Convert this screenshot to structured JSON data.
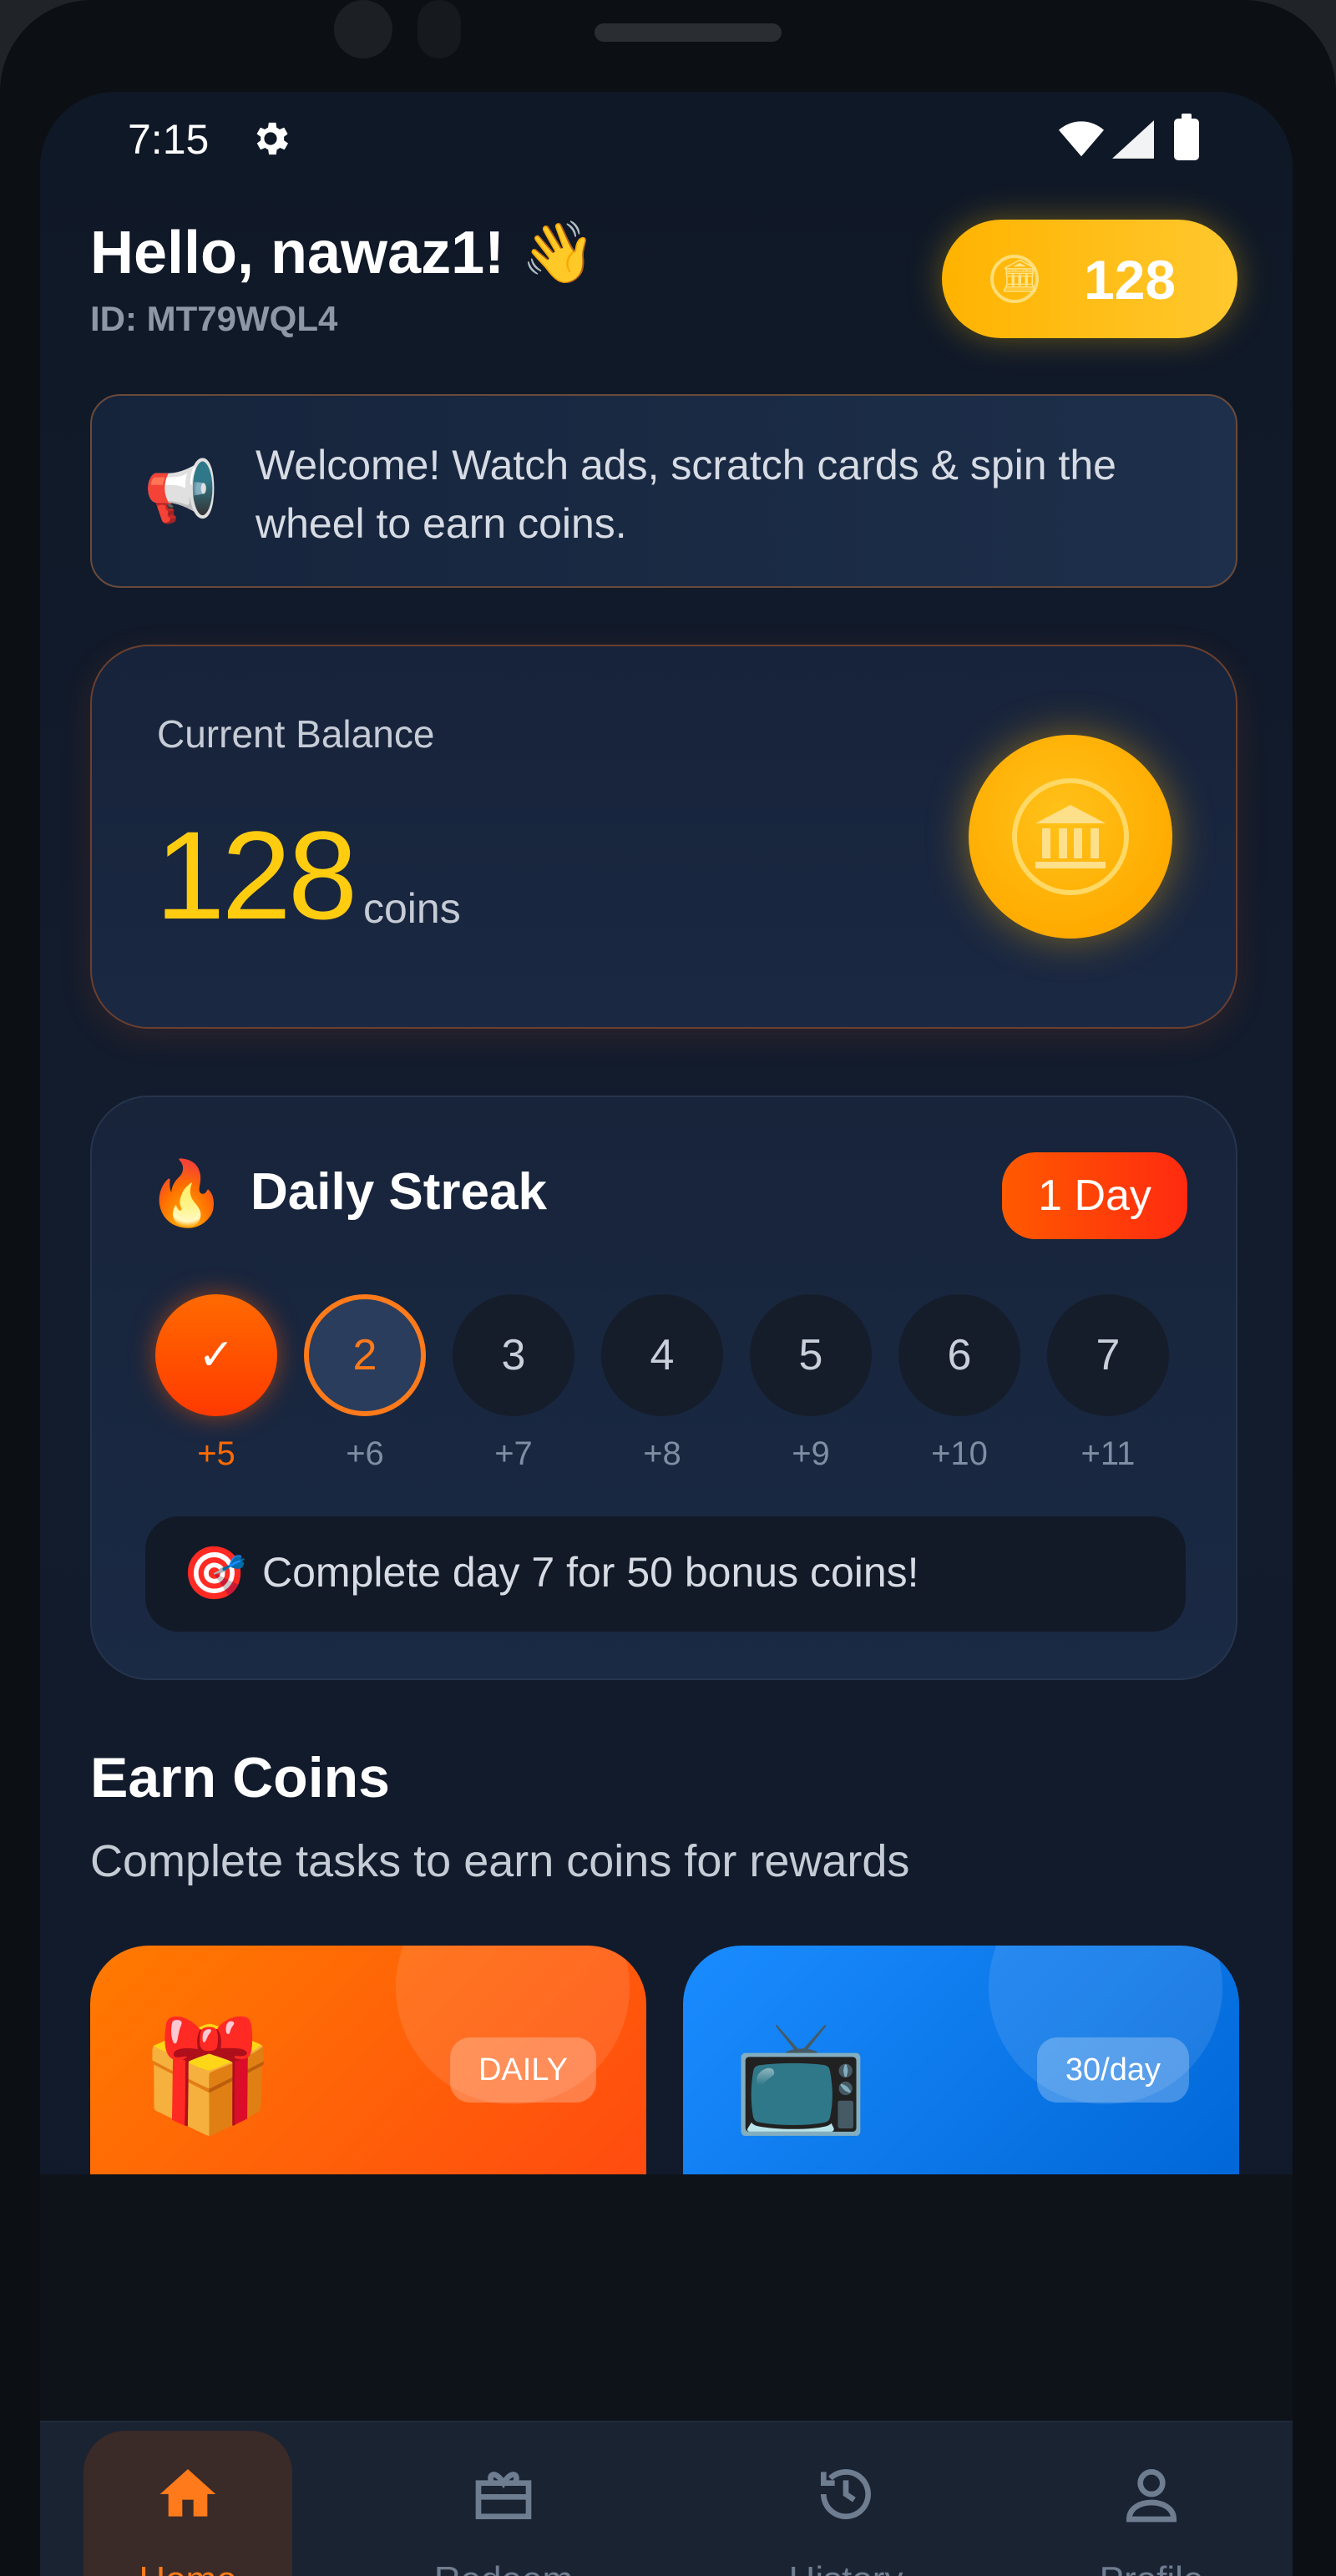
{
  "status_bar": {
    "time": "7:15"
  },
  "header": {
    "greeting": "Hello, nawaz1! 👋",
    "user_id": "ID: MT79WQL4",
    "coins": "128"
  },
  "banner": {
    "text": "Welcome! Watch ads, scratch cards & spin the wheel to earn coins."
  },
  "balance": {
    "label": "Current Balance",
    "value": "128",
    "unit": "coins"
  },
  "streak": {
    "title": "Daily Streak",
    "badge": "1 Day",
    "days": [
      {
        "label": "✓",
        "reward": "+5",
        "state": "done"
      },
      {
        "label": "2",
        "reward": "+6",
        "state": "current"
      },
      {
        "label": "3",
        "reward": "+7",
        "state": "locked"
      },
      {
        "label": "4",
        "reward": "+8",
        "state": "locked"
      },
      {
        "label": "5",
        "reward": "+9",
        "state": "locked"
      },
      {
        "label": "6",
        "reward": "+10",
        "state": "locked"
      },
      {
        "label": "7",
        "reward": "+11",
        "state": "locked"
      }
    ],
    "goal": "Complete day 7 for 50 bonus coins!"
  },
  "earn": {
    "title": "Earn Coins",
    "subtitle": "Complete tasks to earn coins for rewards",
    "cards": [
      {
        "icon": "gift-icon",
        "tag": "DAILY",
        "color": "#ff6a00"
      },
      {
        "icon": "tv-icon",
        "tag": "30/day",
        "color": "#1a8cff"
      }
    ]
  },
  "nav": {
    "items": [
      {
        "label": "Home",
        "icon": "home-icon",
        "active": true
      },
      {
        "label": "Redeem",
        "icon": "gift-card-icon",
        "active": false
      },
      {
        "label": "History",
        "icon": "history-icon",
        "active": false
      },
      {
        "label": "Profile",
        "icon": "profile-icon",
        "active": false
      }
    ]
  },
  "colors": {
    "accent_orange": "#ff7a1a",
    "coin_gold": "#ffcc10",
    "background": "#111a2a"
  }
}
